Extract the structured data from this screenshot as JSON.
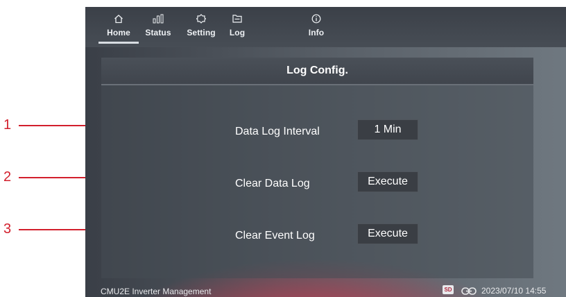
{
  "nav": {
    "tabs": [
      {
        "label": "Home",
        "icon": "home-icon"
      },
      {
        "label": "Status",
        "icon": "bar-chart-icon"
      },
      {
        "label": "Setting",
        "icon": "gear-icon"
      },
      {
        "label": "Log",
        "icon": "log-icon"
      },
      {
        "label": "Info",
        "icon": "info-icon"
      }
    ],
    "active": "Home"
  },
  "panel": {
    "title": "Log Config.",
    "rows": [
      {
        "label": "Data Log Interval",
        "value": "1 Min"
      },
      {
        "label": "Clear Data Log",
        "value": "Execute"
      },
      {
        "label": "Clear Event Log",
        "value": "Execute"
      }
    ]
  },
  "footer": {
    "app_name": "CMU2E Inverter Management",
    "sd_label": "SD",
    "datetime": "2023/07/10 14:55"
  },
  "callouts": [
    "1",
    "2",
    "3"
  ],
  "colors": {
    "callout": "#d21f2c",
    "accent_glow": "#d6344c"
  }
}
